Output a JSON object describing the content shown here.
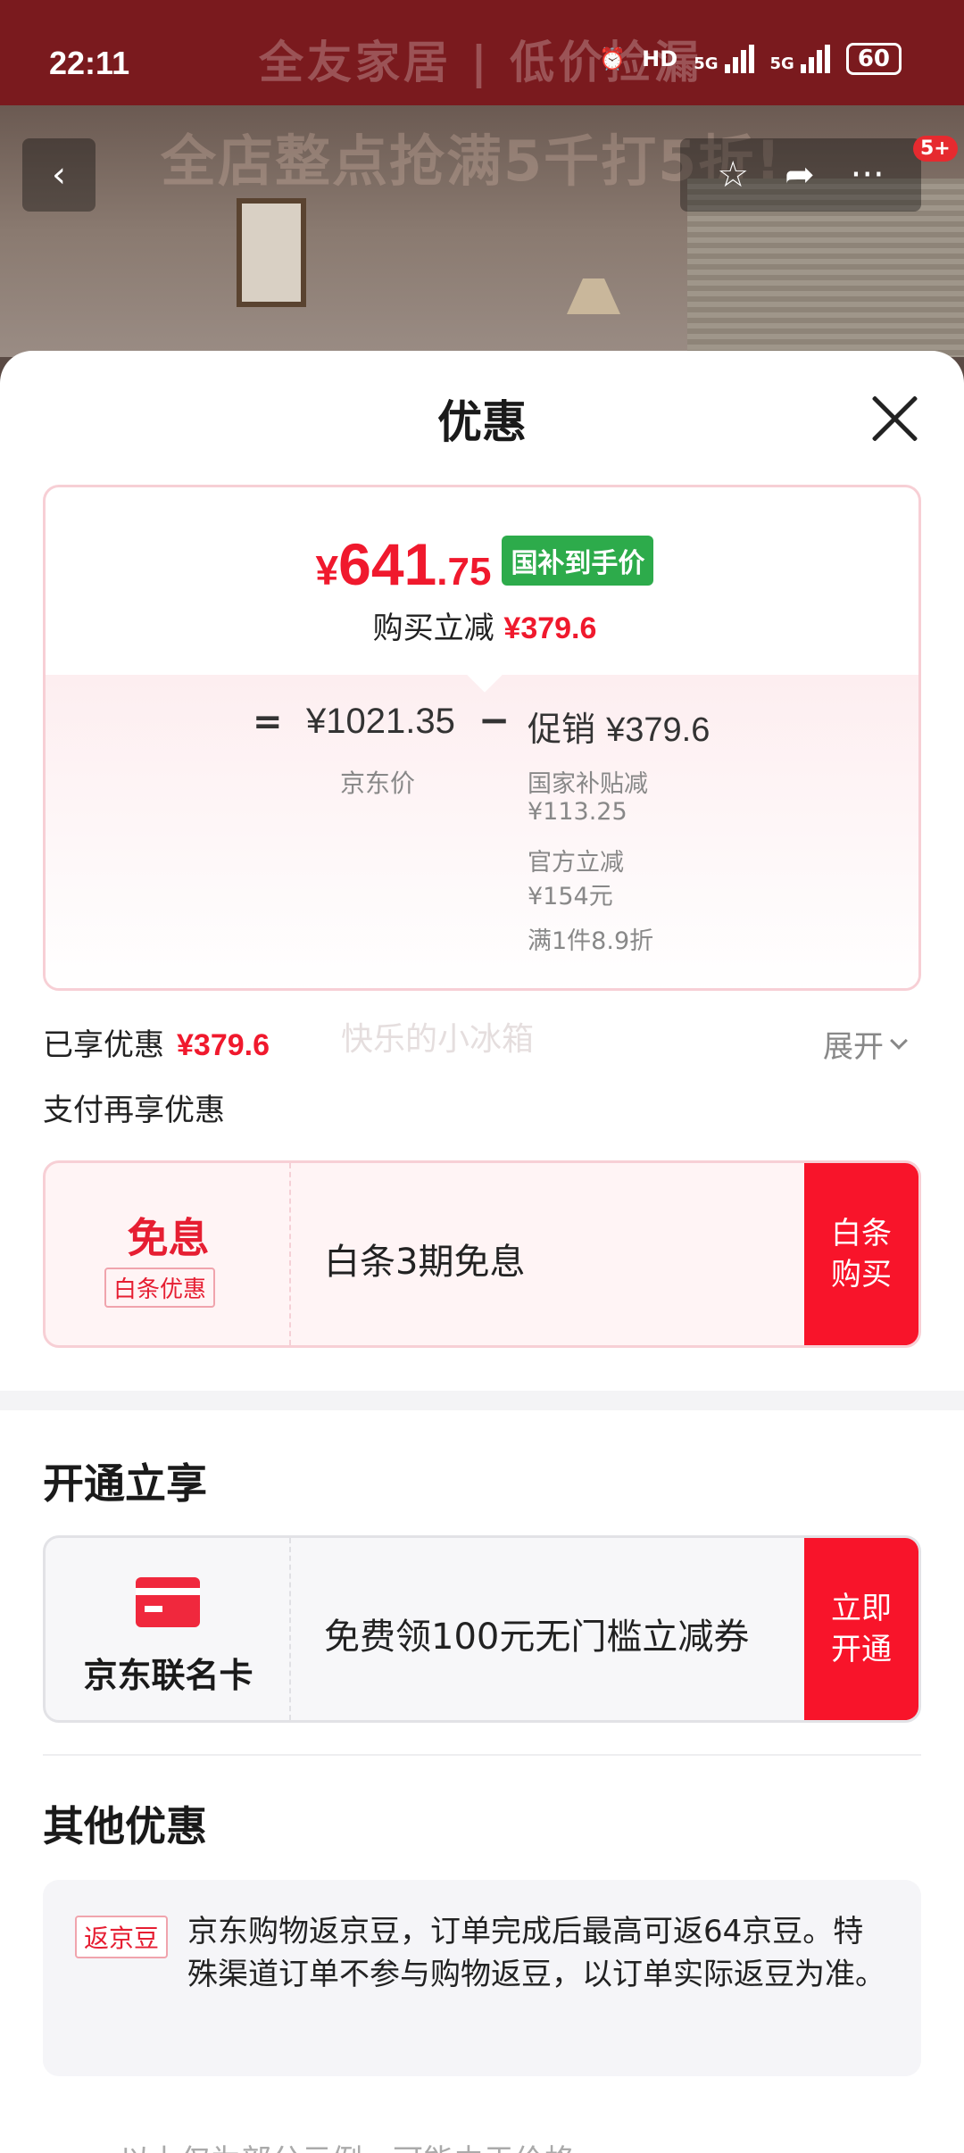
{
  "status_bar": {
    "time": "22:11",
    "network_1": "5G",
    "network_2": "5G",
    "hd_label": "HD",
    "battery": "60"
  },
  "background": {
    "banner_line1": "全友家居 | 低价捡漏",
    "banner_line2": "全店整点抢满5千打5折!",
    "notification_badge": "5+"
  },
  "sheet": {
    "title": "优惠",
    "price_card": {
      "currency": "¥",
      "price_int": "641",
      "price_dec": ".75",
      "price_tag": "国补到手价",
      "buy_reduce_label": "购买立减",
      "buy_reduce_value": "¥379.6",
      "equals": "=",
      "jd_price": "¥1021.35",
      "jd_price_label": "京东价",
      "minus": "−",
      "promo_label": "促销",
      "promo_value": "¥379.6",
      "promo_lines": [
        "国家补贴减",
        "¥113.25",
        "官方立减",
        "¥154元",
        "满1件8.9折"
      ]
    },
    "enjoyed_label": "已享优惠",
    "enjoyed_value": "¥379.6",
    "expand_label": "展开",
    "watermark": "快乐的小冰箱",
    "pay_more_label": "支付再享优惠",
    "baitiao": {
      "big": "免息",
      "small": "白条优惠",
      "desc": "白条3期免息",
      "button": "白条购买"
    },
    "open_section_title": "开通立享",
    "cobrand_card": {
      "name": "京东联名卡",
      "desc": "免费领100元无门槛立减券",
      "button": "立即开通"
    },
    "other_section_title": "其他优惠",
    "other": {
      "tag": "返京豆",
      "text": "京东购物返京豆，订单完成后最高可返64京豆。特殊渠道订单不参与购物返豆，以订单实际返豆为准。"
    },
    "bottom_cut_text": "…以上仅为部分示例，可能由于价格…"
  },
  "colors": {
    "accent_red": "#f0192d",
    "tag_green": "#2dab4b",
    "button_red": "#f8142a"
  }
}
